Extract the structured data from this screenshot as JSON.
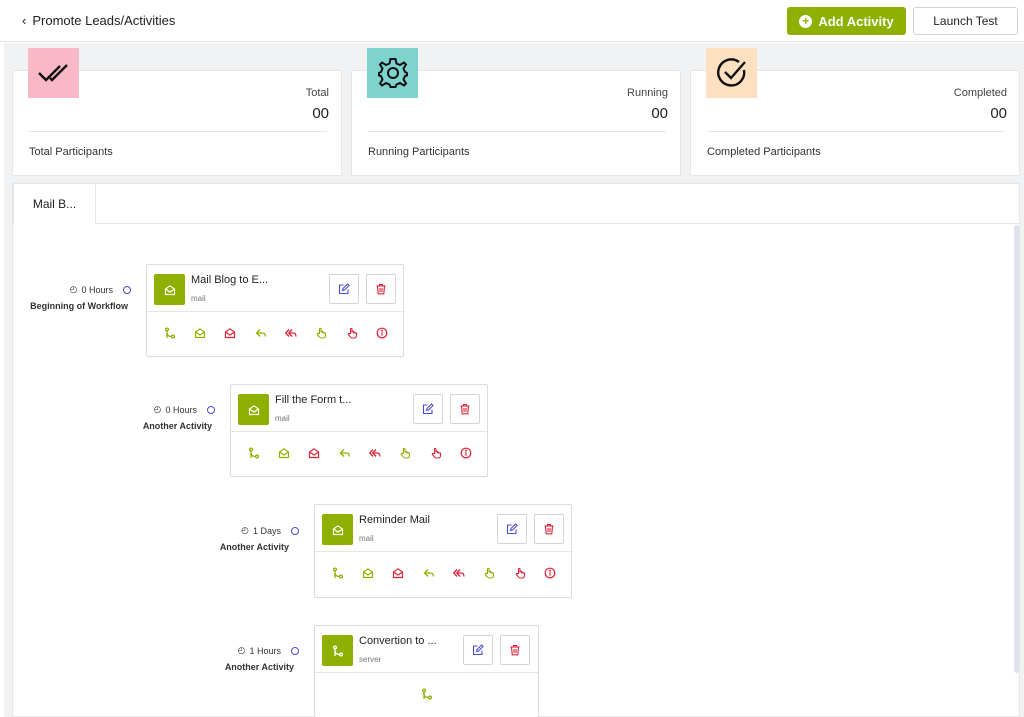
{
  "header": {
    "back_label": "Promote Leads/Activities",
    "add_activity_label": "Add Activity",
    "launch_test_label": "Launch Test"
  },
  "stats": [
    {
      "top_label": "Total",
      "value": "00",
      "bottom_label": "Total Participants",
      "icon": "double-check-icon",
      "color": "#f8b8c8"
    },
    {
      "top_label": "Running",
      "value": "00",
      "bottom_label": "Running Participants",
      "icon": "gear-icon",
      "color": "#7fd3cf"
    },
    {
      "top_label": "Completed",
      "value": "00",
      "bottom_label": "Completed Participants",
      "icon": "check-circle-icon",
      "color": "#fde0c0"
    }
  ],
  "tabs": [
    {
      "label": "Mail B..."
    }
  ],
  "colors": {
    "accent": "#8fb000",
    "edit": "#4a4ad8",
    "delete": "#e0243a"
  },
  "workflow": [
    {
      "time": "0 Hours",
      "sub": "Beginning of Workflow",
      "title": "Mail Blog to E...",
      "type": "mail",
      "icon": "mail-open-icon"
    },
    {
      "time": "0 Hours",
      "sub": "Another Activity",
      "title": "Fill the Form t...",
      "type": "mail",
      "icon": "mail-open-icon"
    },
    {
      "time": "1 Days",
      "sub": "Another Activity",
      "title": "Reminder Mail",
      "type": "mail",
      "icon": "mail-open-icon"
    },
    {
      "time": "1 Hours",
      "sub": "Another Activity",
      "title": "Convertion to ...",
      "type": "server",
      "icon": "branch-icon"
    }
  ],
  "trigger_icons": [
    "branch-icon",
    "mail-opened-icon",
    "mail-unopened-icon",
    "reply-icon",
    "not-replied-icon",
    "clicked-icon",
    "not-clicked-icon",
    "info-icon"
  ]
}
